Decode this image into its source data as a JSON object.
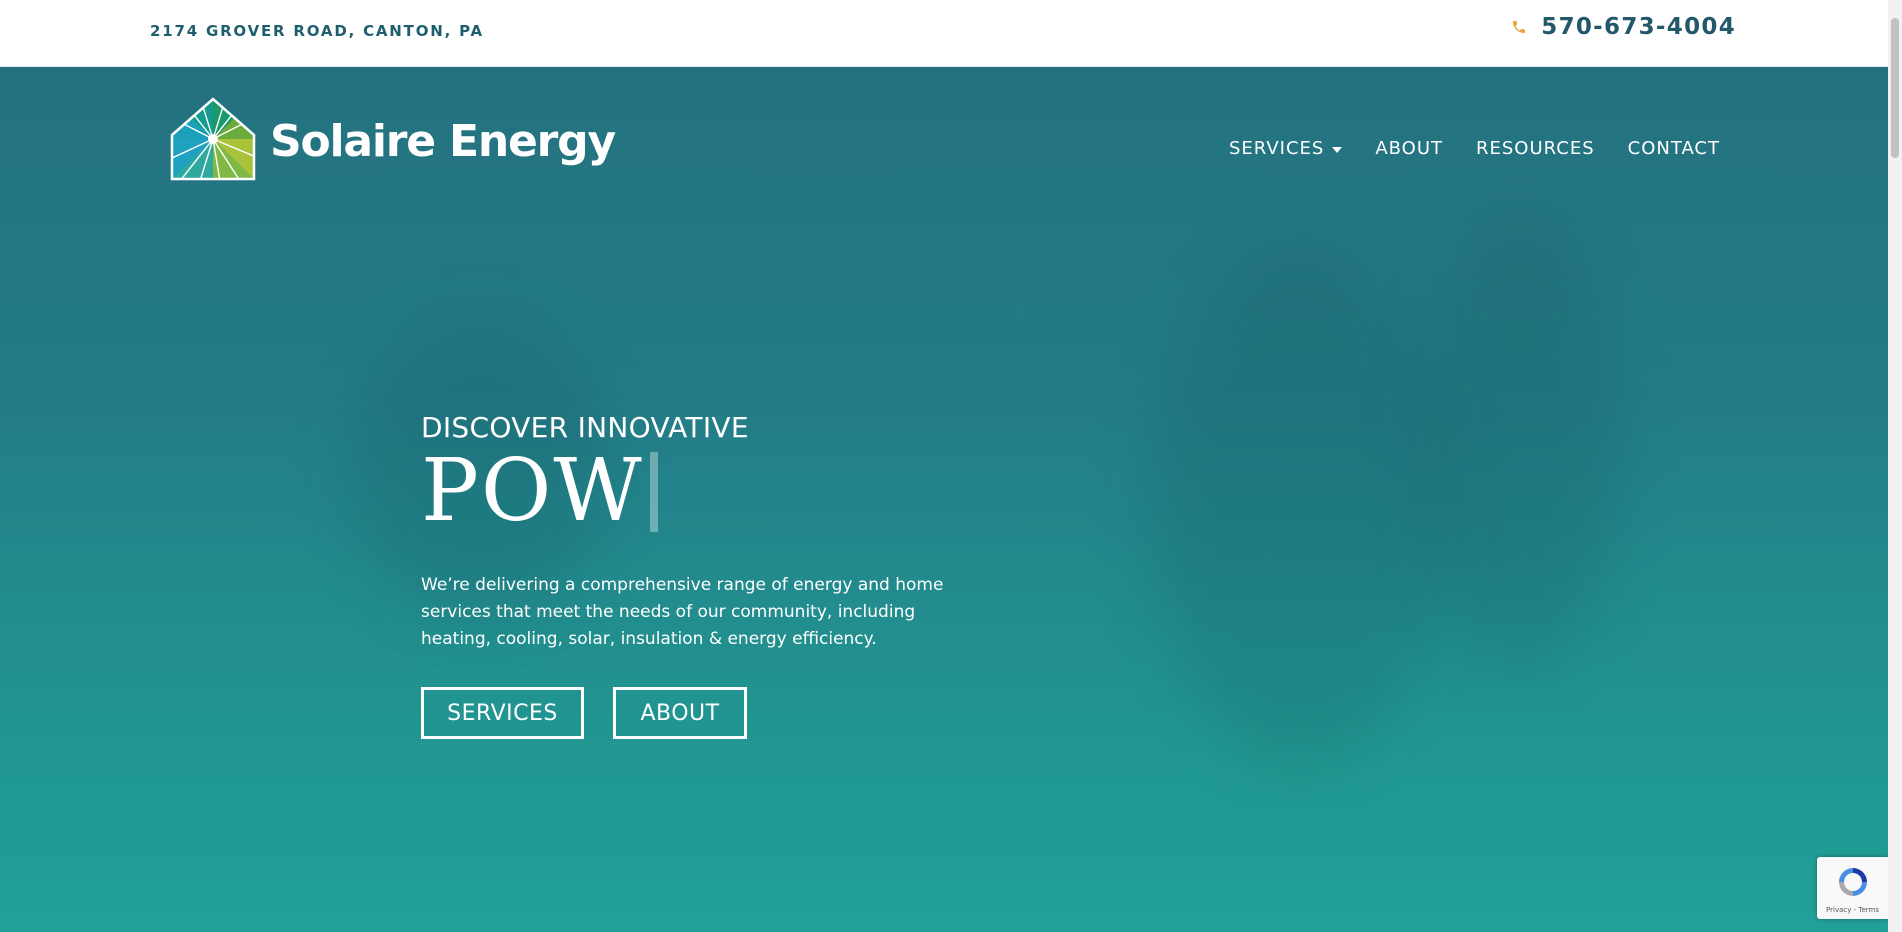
{
  "topbar": {
    "address": "2174 GROVER ROAD, CANTON, PA",
    "phone_icon": "phone-icon",
    "phone": "570-673-4004"
  },
  "header": {
    "logo_text": "Solaire Energy",
    "logo_icon": "house-sunburst-logo",
    "nav": {
      "services": "SERVICES",
      "about": "ABOUT",
      "resources": "RESOURCES",
      "contact": "CONTACT"
    }
  },
  "hero": {
    "eyebrow": "DISCOVER INNOVATIVE",
    "headline": "POW",
    "description": "We’re delivering a comprehensive range of energy and home services that meet the needs of our community,  including heating, cooling, solar, insulation & energy efficiency.",
    "buttons": {
      "services": "SERVICES",
      "about": "ABOUT"
    }
  },
  "recaptcha": {
    "links": "Privacy - Terms"
  },
  "colors": {
    "brand_dark": "#22586a",
    "hero_top": "#24717f",
    "hero_bottom": "#21a098",
    "phone_icon": "#e8a23a"
  }
}
